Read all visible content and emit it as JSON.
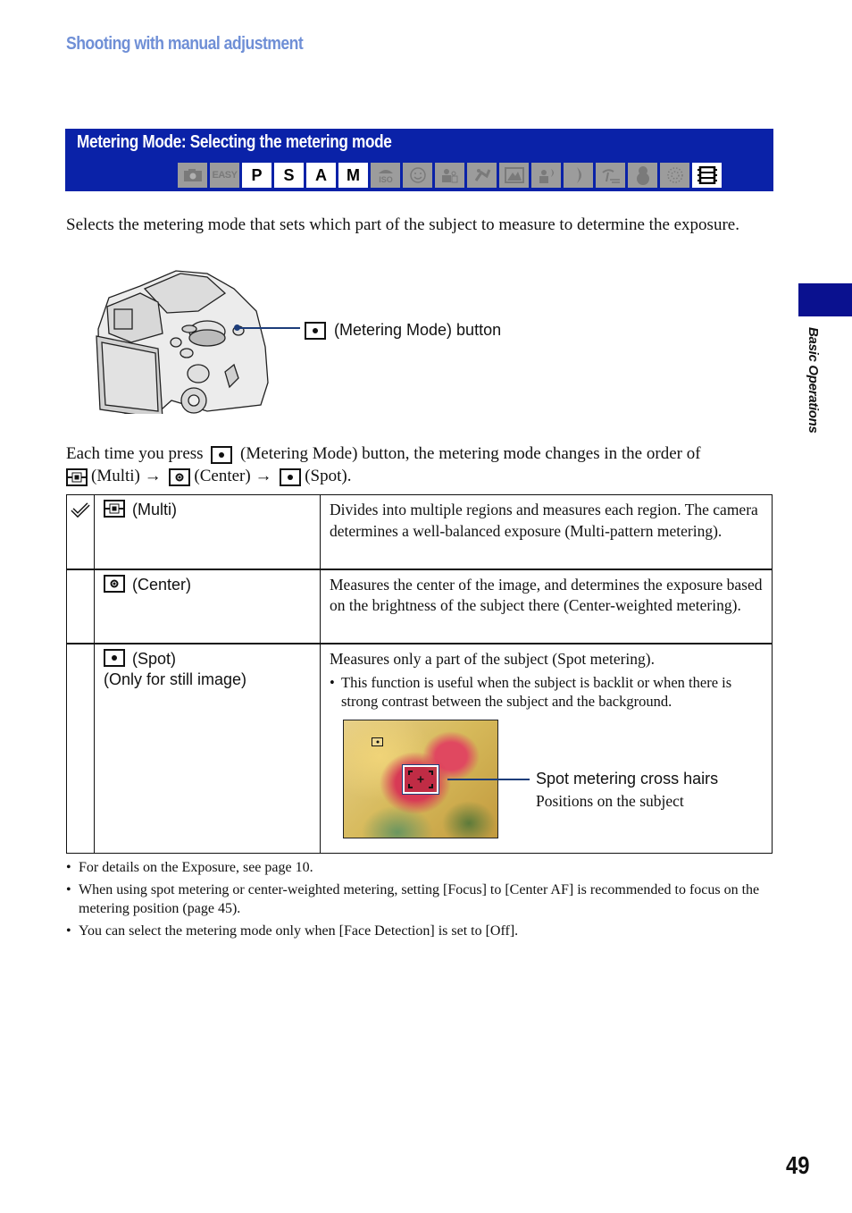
{
  "section_header": "Shooting with manual adjustment",
  "banner": {
    "title": "Metering Mode: Selecting the metering mode",
    "mode_icons": [
      {
        "name": "auto-camera",
        "label": "",
        "active": false
      },
      {
        "name": "easy",
        "label": "EASY",
        "active": false
      },
      {
        "name": "program",
        "label": "P",
        "active": true
      },
      {
        "name": "shutter-priority",
        "label": "S",
        "active": true
      },
      {
        "name": "aperture-priority",
        "label": "A",
        "active": true
      },
      {
        "name": "manual",
        "label": "M",
        "active": true
      },
      {
        "name": "high-sensitivity",
        "label": "",
        "active": false
      },
      {
        "name": "smile-shutter",
        "label": "",
        "active": false
      },
      {
        "name": "soft-snap",
        "label": "",
        "active": false
      },
      {
        "name": "advanced-sports",
        "label": "",
        "active": false
      },
      {
        "name": "landscape",
        "label": "",
        "active": false
      },
      {
        "name": "twilight-portrait",
        "label": "",
        "active": false
      },
      {
        "name": "twilight",
        "label": "",
        "active": false
      },
      {
        "name": "beach",
        "label": "",
        "active": false
      },
      {
        "name": "snow",
        "label": "",
        "active": false
      },
      {
        "name": "fireworks",
        "label": "",
        "active": false
      },
      {
        "name": "movie",
        "label": "",
        "active": true
      }
    ]
  },
  "intro": "Selects the metering mode that sets which part of the subject to measure to determine the exposure.",
  "camera_callout": "(Metering Mode) button",
  "order_text": {
    "part1": "Each time you press",
    "part2": "(Metering Mode) button, the metering mode changes in the order of",
    "multi": "(Multi)",
    "arrow": "→",
    "center": "(Center)",
    "spot": "(Spot)."
  },
  "modes": [
    {
      "default": true,
      "icon": "multi",
      "label": "(Multi)",
      "sublabel": "",
      "description": "Divides into multiple regions and measures each region. The camera determines a well-balanced exposure (Multi-pattern metering)."
    },
    {
      "default": false,
      "icon": "center",
      "label": "(Center)",
      "sublabel": "",
      "description": "Measures the center of the image, and determines the exposure based on the brightness of the subject there (Center-weighted metering)."
    },
    {
      "default": false,
      "icon": "spot",
      "label": "(Spot)",
      "sublabel": "(Only for still image)",
      "description": "Measures only a part of the subject (Spot metering).",
      "bullet": "This function is useful when the subject is backlit or when there is strong contrast between the subject and the background.",
      "figure": {
        "callout_title": "Spot metering cross hairs",
        "callout_sub": "Positions on the subject"
      }
    }
  ],
  "notes": [
    "For details on the Exposure, see page 10.",
    "When using spot metering or center-weighted metering, setting [Focus] to [Center AF] is recommended to focus on the metering position (page 45).",
    "You can select the metering mode only when [Face Detection] is set to [Off]."
  ],
  "side_tab_label": "Basic Operations",
  "page_number": "49",
  "colors": {
    "banner_blue": "#0a22a8",
    "header_blue": "#6f8fd6",
    "side_tab_blue": "#0a118f"
  }
}
